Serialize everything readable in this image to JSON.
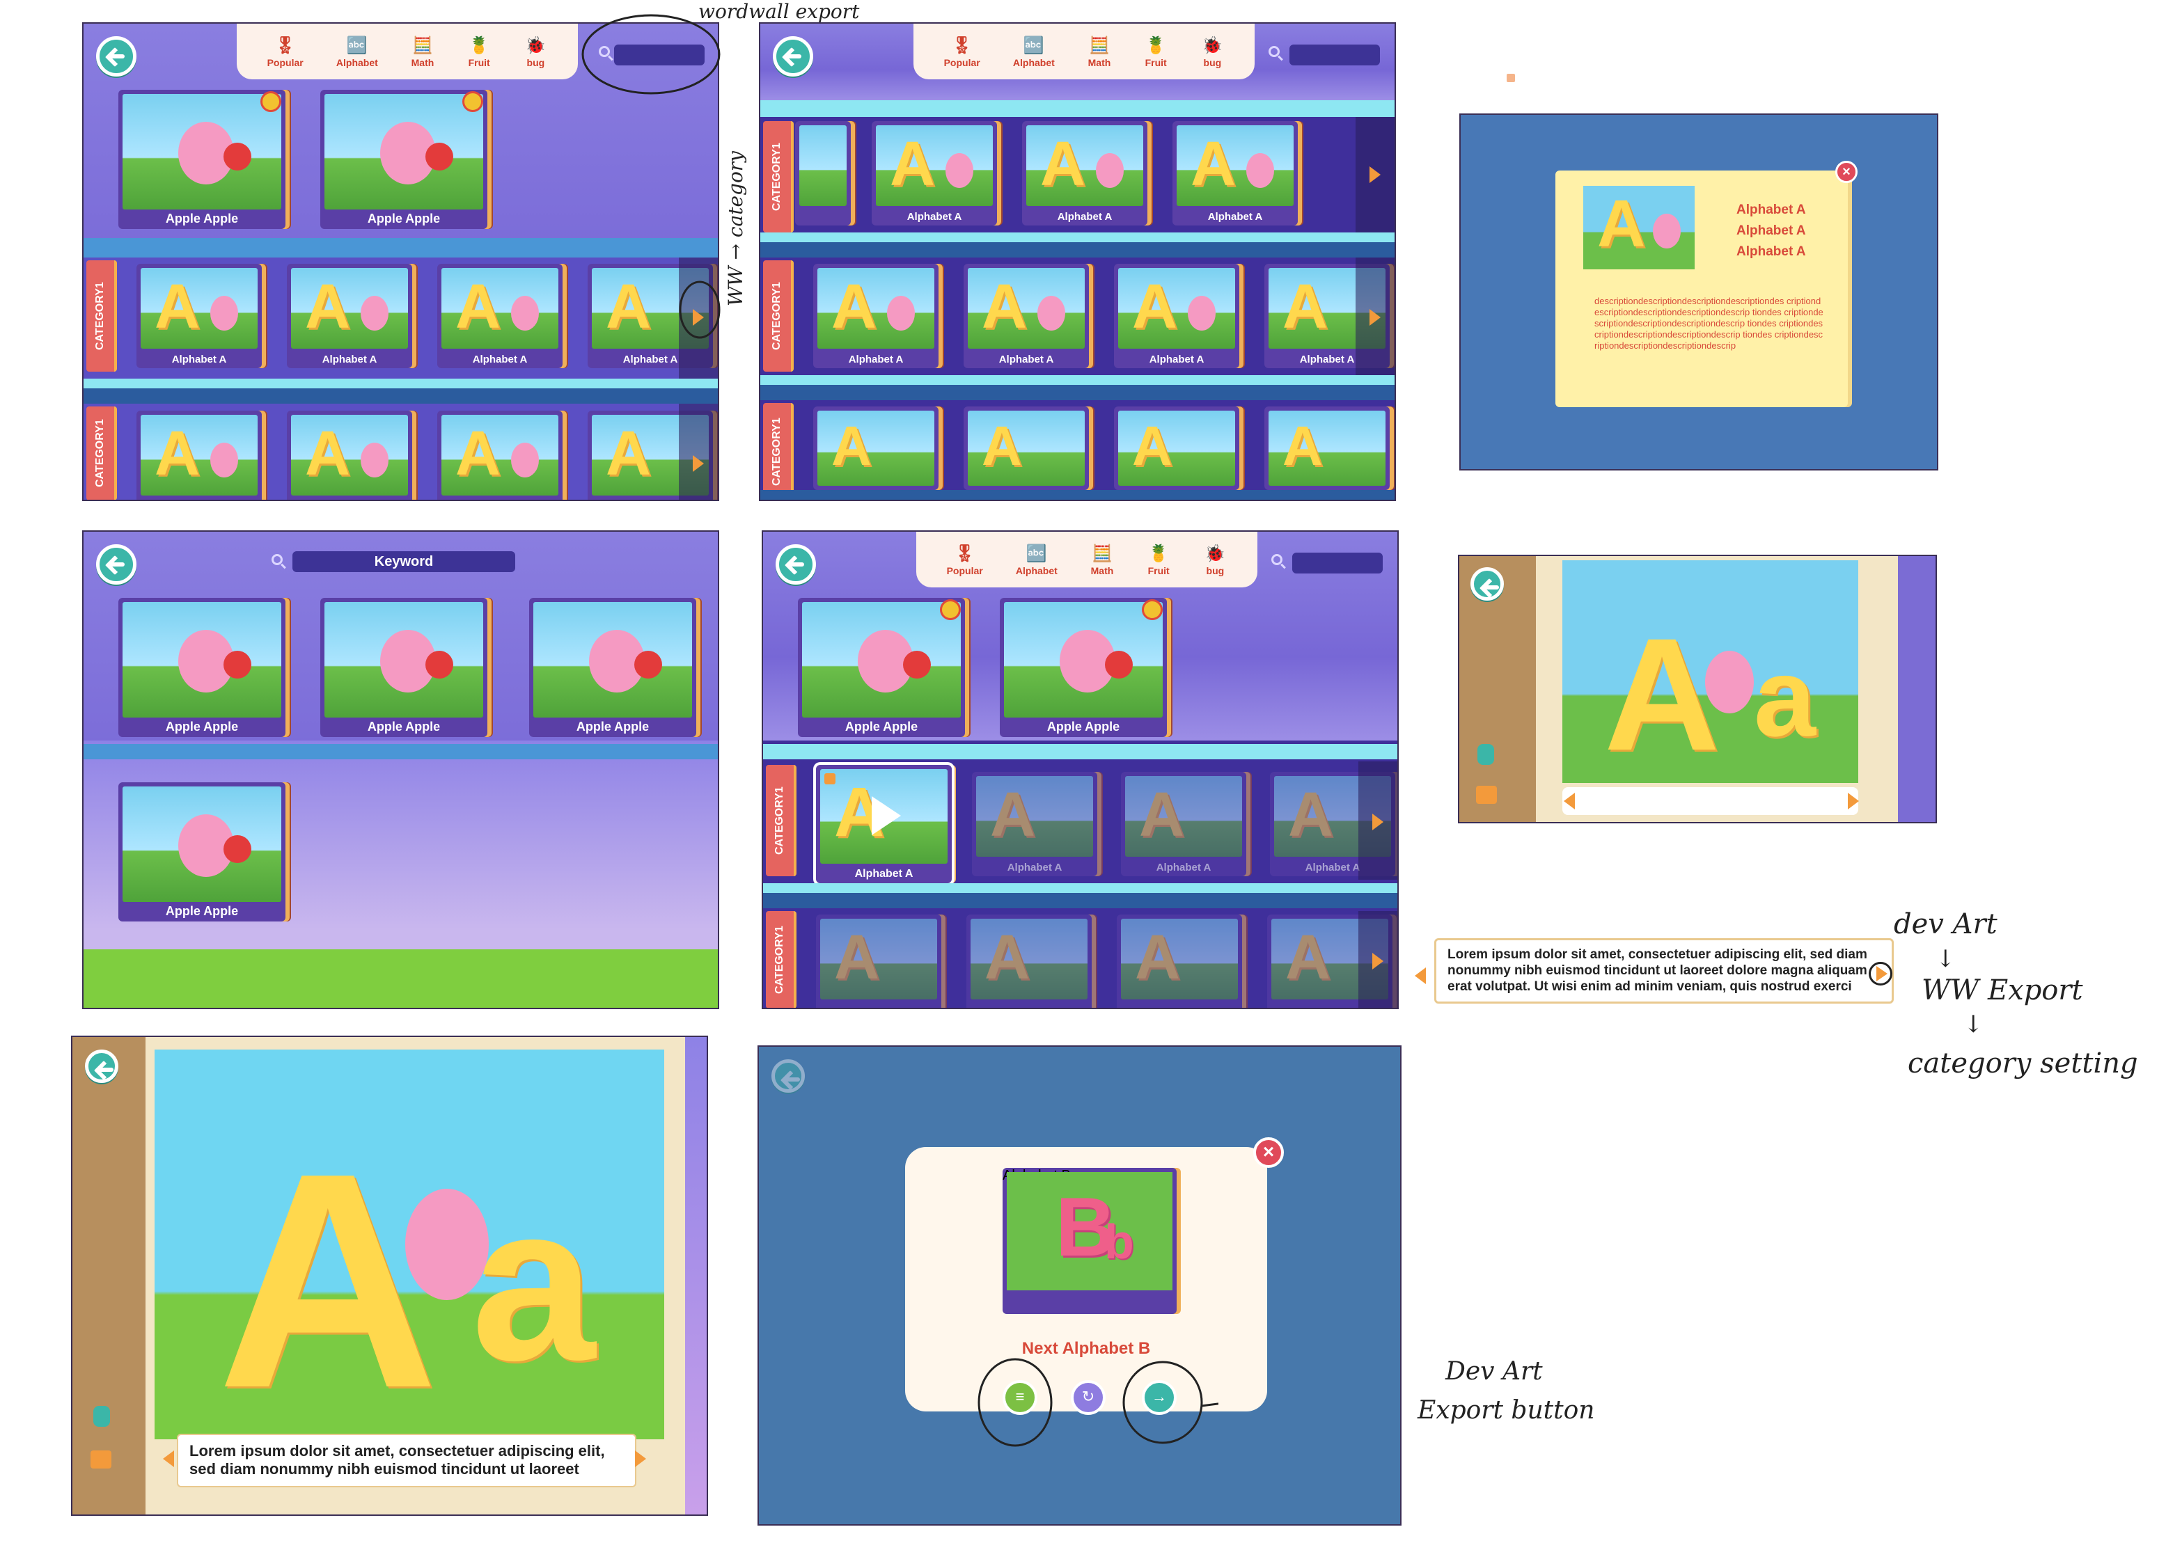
{
  "categories": [
    {
      "label": "Popular",
      "icon": "ribbon-icon"
    },
    {
      "label": "Alphabet",
      "icon": "abc-icon"
    },
    {
      "label": "Math",
      "icon": "calculator-icon"
    },
    {
      "label": "Fruit",
      "icon": "pineapple-icon"
    },
    {
      "label": "bug",
      "icon": "ladybug-icon"
    }
  ],
  "category_bar_label": "CATEGORY1",
  "book_apple": "Apple Apple",
  "book_alpha": "Alphabet A",
  "book_alpha_b": "Alphabet B",
  "search_keyword": "Keyword",
  "popup": {
    "title_lines": [
      "Alphabet A",
      "Alphabet A",
      "Alphabet A"
    ],
    "description": "descriptiondescriptiondescriptiondescriptiondes criptiondescriptiondescriptiondescriptiondescrip tiondes criptiondescriptiondescriptiondescriptiondescrip tiondes criptiondescriptiondescriptiondescriptiondescrip tiondes criptiondescriptiondescriptiondescriptiondescrip"
  },
  "caption_long": "Lorem ipsum dolor sit amet, consectetuer adipiscing elit, sed diam nonummy nibh euismod tincidunt ut laoreet dolore magna aliquam erat volutpat. Ut wisi enim ad minim veniam, quis nostrud exerci",
  "caption_short": "Lorem ipsum dolor sit amet, consectetuer adipiscing elit, sed diam nonummy nibh euismod tincidunt ut laoreet",
  "next_label": "Next Alphabet B",
  "annotations": {
    "wordwall_export": "wordwall export",
    "ww_category": "WW → category",
    "dev_art": "dev Art",
    "ww_export": "WW Export",
    "category_setting": "category setting",
    "dev_art_2": "Dev Art",
    "export_button": "Export button"
  },
  "colors": {
    "accent_teal": "#3bb6a8",
    "sky_purple": "#7767d6",
    "label_red": "#d84a3a",
    "category_red": "#e5645f"
  }
}
